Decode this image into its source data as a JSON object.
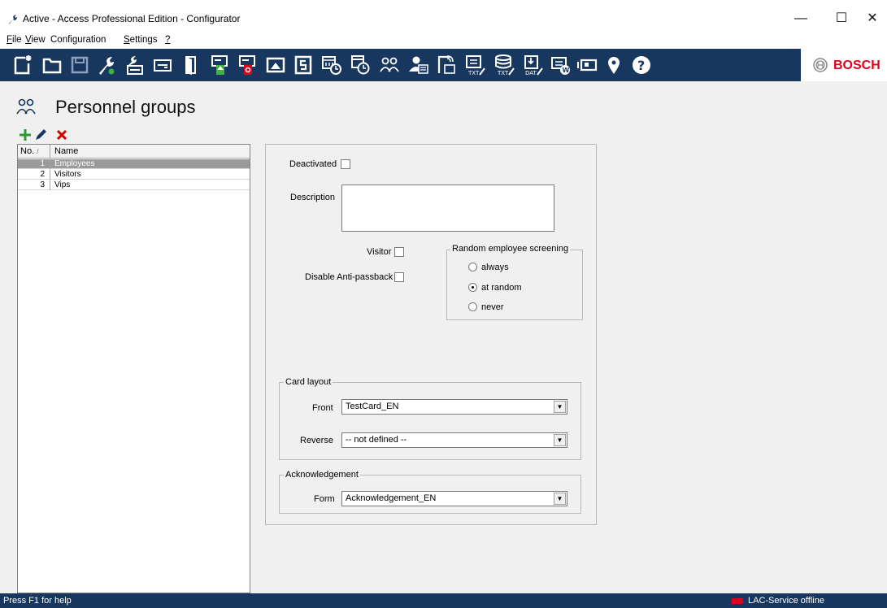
{
  "window": {
    "title": "Active - Access Professional Edition - Configurator",
    "min": "—",
    "max": "☐",
    "close": "✕"
  },
  "menu": [
    "File",
    "View",
    "Configuration",
    "Settings",
    "?"
  ],
  "menu_access_keys": [
    "F",
    "V",
    "",
    "S",
    "?"
  ],
  "brand": {
    "name": "BOSCH",
    "color": "#e2001a"
  },
  "toolbar_icons": [
    "new-icon",
    "open-folder-icon",
    "save-icon",
    "wrench-icon",
    "devices-icon",
    "card-reader-icon",
    "door-icon",
    "entrance-icon",
    "exit-icon",
    "area-icon",
    "calendar-icon",
    "time-model-icon",
    "day-model-icon",
    "personnel-groups-icon",
    "personnel-icon",
    "badge-icon",
    "text-list-icon",
    "text-database-icon",
    "data-export-icon",
    "workstation-icon",
    "camera-icon",
    "map-pin-icon",
    "help-icon"
  ],
  "page": {
    "title": "Personnel groups"
  },
  "list": {
    "columns": [
      "No.",
      "Name"
    ],
    "sort_glyph": "/",
    "rows": [
      {
        "no": "1",
        "name": "Employees",
        "selected": true
      },
      {
        "no": "2",
        "name": "Visitors",
        "selected": false
      },
      {
        "no": "3",
        "name": "Vips",
        "selected": false
      }
    ]
  },
  "form": {
    "deactivated": "Deactivated",
    "description": "Description",
    "visitor": "Visitor",
    "disable_anti_passback": "Disable Anti-passback",
    "screening": {
      "title": "Random employee screening",
      "options": [
        "always",
        "at random",
        "never"
      ],
      "selected": "at random"
    },
    "card_layout": {
      "title": "Card layout",
      "front_label": "Front",
      "front_value": "TestCard_EN",
      "reverse_label": "Reverse",
      "reverse_value": "-- not defined --"
    },
    "acknowledgement": {
      "title": "Acknowledgement",
      "form_label": "Form",
      "form_value": "Acknowledgement_EN"
    }
  },
  "status": {
    "help": "Press F1 for help",
    "service": "LAC-Service offline",
    "service_color": "#e2001a"
  },
  "colors": {
    "toolbar": "#18375f",
    "selection": "#9a9a9a"
  }
}
